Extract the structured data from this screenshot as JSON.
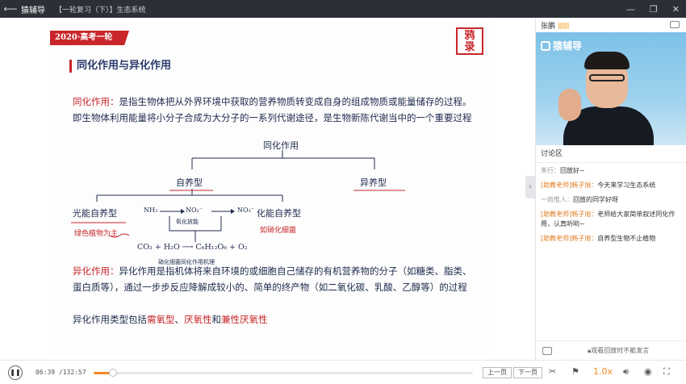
{
  "titlebar": {
    "app_name": "猿辅导",
    "course_title": "【一轮复习（下）】生态系统"
  },
  "slide": {
    "badge": "2020·高考一轮",
    "stamp_lines": [
      "鸦",
      "录"
    ],
    "heading": "同化作用与异化作用",
    "p1_term": "同化作用：",
    "p1_text": "是指生物体把从外界环境中获取的营养物质转变成自身的组成物质或能量储存的过程。即生物体利用能量将小分子合成为大分子的一系列代谢途径，是生物新陈代谢当中的一个重要过程",
    "diagram": {
      "root": "同化作用",
      "autotroph": "自养型",
      "heterotroph": "异养型",
      "photo": "光能自养型",
      "photo_note": "绿色植物为主",
      "chemo": "化能自养型",
      "chemo_note": "如硝化细菌",
      "nh3": "NH₃",
      "no2": "NO₂⁻",
      "no3": "NO₃⁻",
      "oxidize": "氧化放能",
      "reaction": "CO₂ + H₂O ⟶ C₆H₁₂O₆ + O₂",
      "mechanism": "硝化细菌同化作用机理"
    },
    "p2_term": "异化作用：",
    "p2_text": "异化作用是指机体将来自环境的或细胞自己储存的有机营养物的分子（如糖类、脂类、蛋白质等），通过一步步反应降解成较小的、简单的终产物（如二氧化碳、乳酸、乙醇等）的过程",
    "p3_prefix": "异化作用类型包括",
    "p3_a": "需氧型",
    "p3_sep1": "、",
    "p3_b": "厌氧性",
    "p3_sep2": "和",
    "p3_c": "兼性厌氧性"
  },
  "sidebar": {
    "teacher_name": "张鹏",
    "volume_bars": "||||||||",
    "logo_text": "猿辅导",
    "discussion_title": "讨论区",
    "messages": [
      {
        "user": "朱行：",
        "text": "回放好~",
        "style": "gray"
      },
      {
        "user": "[助教老师]韩子旭：",
        "text": "今天来学习生态系统",
        "style": "orange"
      },
      {
        "user": "一尚惟人：",
        "text": "回放的同学好呀",
        "style": "gray"
      },
      {
        "user": "[助教老师]韩子旭：",
        "text": "老师给大家简单叙述同化作用，认真听哟~",
        "style": "orange"
      },
      {
        "user": "[助教老师]韩子旭：",
        "text": "自养型生物不止植物",
        "style": "orange"
      }
    ],
    "footer_text": "观看回放时不能发言"
  },
  "controls": {
    "current_time": "06:39",
    "total_time": "132:57",
    "progress_fraction": 0.05,
    "prev_label": "上一页",
    "next_label": "下一页",
    "speed": "1.0x"
  }
}
